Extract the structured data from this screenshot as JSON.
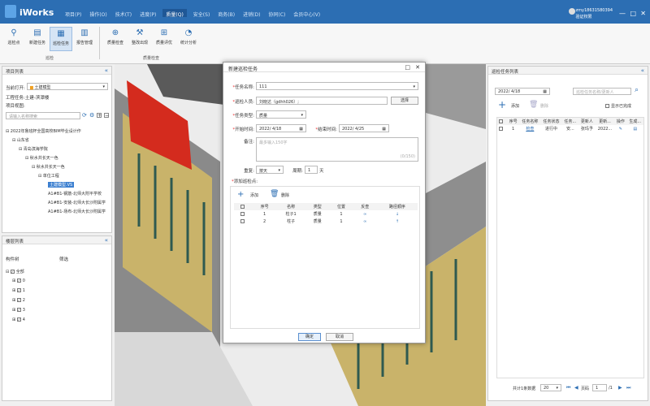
{
  "app": {
    "title": "iWorks",
    "user_name": "zmy18631580394",
    "user_org": "验证权限"
  },
  "nav": [
    "项目(P)",
    "操作(O)",
    "技术(T)",
    "进度(P)",
    "质量(Q)",
    "安全(S)",
    "商务(B)",
    "进销(D)",
    "协同(C)",
    "会员中心(V)"
  ],
  "ribbon": {
    "buttons": [
      {
        "label": "巡检点",
        "icon": "pin-icon"
      },
      {
        "label": "新建任务",
        "icon": "new-task-icon"
      },
      {
        "label": "巡检任务",
        "icon": "inspection-task-icon"
      },
      {
        "label": "报告管理",
        "icon": "report-icon"
      },
      {
        "label": "质量检查",
        "icon": "quality-check-icon"
      },
      {
        "label": "整改出现",
        "icon": "rectify-icon"
      },
      {
        "label": "质量评优",
        "icon": "evaluate-icon"
      },
      {
        "label": "统计分析",
        "icon": "analysis-icon"
      }
    ],
    "group1": "巡检",
    "group2": "质量检查"
  },
  "project_panel": {
    "title": "项目列表",
    "open_label": "当前打开:",
    "open_value": "土建模型",
    "engineering_label": "工程任务:",
    "engineering_value": "土建-滨潭楼",
    "view_label": "项目视图:",
    "search_placeholder": "请输入名称搜索",
    "tree": [
      "2022年鲁班杯全国高校BIM毕业设计作",
      "山东省",
      "青岛滨海学院",
      "秋水共长天一色",
      "秋水共长天一色",
      "单位工程",
      "土建模型.VS",
      "A1#B1-钢筋-北师大附平学校",
      "A1#B1-安装-北师大长沙附属学",
      "A1#B1-场布-北师大长沙附属学"
    ]
  },
  "floor_panel": {
    "title": "楼层列表",
    "col_name": "构件树",
    "filter": "筛选",
    "items": [
      "全部",
      "0",
      "1",
      "2",
      "3",
      "4"
    ]
  },
  "dialog": {
    "title": "新建巡检任务",
    "task_name_label": "任务名称:",
    "task_name": "111",
    "inspector_label": "巡检人员:",
    "inspector": "刘晓达（gdhh026）;",
    "select_btn": "选择",
    "type_label": "任务类型:",
    "type": "质量",
    "start_label": "开始时间:",
    "start": "2022/ 4/18",
    "end_label": "结束时间:",
    "end": "2022/ 4/25",
    "remark_label": "备注:",
    "remark_placeholder": "最多输入150字",
    "remark_count": "(0/150)",
    "repeat_label": "重复:",
    "repeat": "按天",
    "period_label": "周期:",
    "period": "1",
    "period_unit": "天",
    "points_label": "添加巡检点:",
    "add": "添加",
    "delete": "删除",
    "cols": [
      "序号",
      "名称",
      "类型",
      "位置",
      "反查",
      "路径顺序"
    ],
    "rows": [
      [
        "1",
        "柱子1",
        "质量",
        "1"
      ],
      [
        "2",
        "柱子",
        "质量",
        "1"
      ]
    ],
    "ok": "确定",
    "cancel": "取消"
  },
  "task_panel": {
    "title": "巡检任务列表",
    "date": "2022/ 4/18",
    "search_placeholder": "巡检任务名称/更新人",
    "add": "添加",
    "delete": "删除",
    "show_done": "显示已完成",
    "cols": [
      "序号",
      "任务名称",
      "任务状态",
      "任务...",
      "更新人",
      "更新...",
      "操作",
      "生成..."
    ],
    "rows": [
      [
        "1",
        "检查",
        "进行中",
        "安...",
        "张玛予",
        "2022..."
      ]
    ],
    "total": "共计1条数据",
    "page_size": "20",
    "page_label": "页码",
    "page": "1",
    "page_total": "/1"
  }
}
